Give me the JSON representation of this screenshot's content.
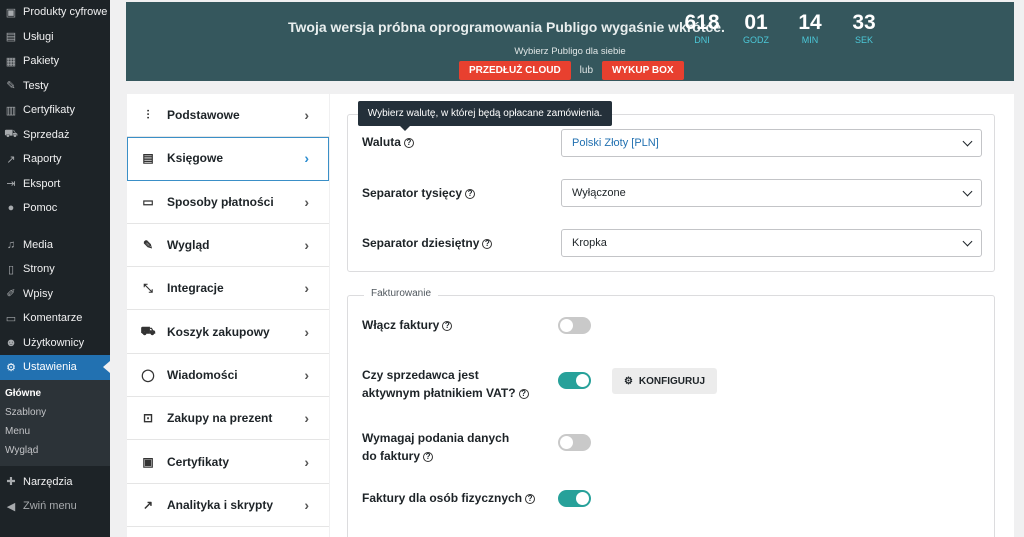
{
  "wp_menu": {
    "group1": [
      {
        "label": "Produkty cyfrowe",
        "icon": "product-icon"
      },
      {
        "label": "Usługi",
        "icon": "services-icon"
      },
      {
        "label": "Pakiety",
        "icon": "packages-icon"
      },
      {
        "label": "Testy",
        "icon": "tests-icon"
      },
      {
        "label": "Certyfikaty",
        "icon": "certificates-icon"
      },
      {
        "label": "Sprzedaż",
        "icon": "cart-icon"
      },
      {
        "label": "Raporty",
        "icon": "chart-icon"
      },
      {
        "label": "Eksport",
        "icon": "export-icon"
      },
      {
        "label": "Pomoc",
        "icon": "help-icon"
      }
    ],
    "group2": [
      {
        "label": "Media",
        "icon": "media-icon"
      },
      {
        "label": "Strony",
        "icon": "pages-icon"
      },
      {
        "label": "Wpisy",
        "icon": "pin-icon"
      },
      {
        "label": "Komentarze",
        "icon": "comments-icon"
      },
      {
        "label": "Użytkownicy",
        "icon": "users-icon"
      },
      {
        "label": "Ustawienia",
        "icon": "settings-icon"
      }
    ],
    "submenu": [
      "Główne",
      "Szablony",
      "Menu",
      "Wygląd"
    ],
    "tools": "Narzędzia",
    "collapse": "Zwiń menu"
  },
  "banner": {
    "message": "Twoja wersja próbna oprogramowania Publigo wygaśnie wkrótce.",
    "countdown": [
      {
        "value": "618",
        "label": "DNI"
      },
      {
        "value": "01",
        "label": "GODZ"
      },
      {
        "value": "14",
        "label": "MIN"
      },
      {
        "value": "33",
        "label": "SEK"
      }
    ],
    "choose": "Wybierz Publigo dla siebie",
    "btn_cloud": "PRZEDŁUŻ CLOUD",
    "or": "lub",
    "btn_box": "WYKUP BOX"
  },
  "settings_nav": [
    {
      "label": "Podstawowe",
      "icon": "sliders-icon"
    },
    {
      "label": "Księgowe",
      "icon": "document-icon"
    },
    {
      "label": "Sposoby płatności",
      "icon": "credit-card-icon"
    },
    {
      "label": "Wygląd",
      "icon": "pencil-icon"
    },
    {
      "label": "Integracje",
      "icon": "integrations-icon"
    },
    {
      "label": "Koszyk zakupowy",
      "icon": "cart-icon"
    },
    {
      "label": "Wiadomości",
      "icon": "message-icon"
    },
    {
      "label": "Zakupy na prezent",
      "icon": "gift-icon"
    },
    {
      "label": "Certyfikaty",
      "icon": "certificate-icon"
    },
    {
      "label": "Analityka i skrypty",
      "icon": "analytics-icon"
    }
  ],
  "currency_section": {
    "tooltip": "Wybierz walutę, w której będą opłacane zamówienia.",
    "currency_label": "Waluta",
    "currency_value": "Polski Złoty [PLN]",
    "thousands_label": "Separator tysięcy",
    "thousands_value": "Wyłączone",
    "decimal_label": "Separator dziesiętny",
    "decimal_value": "Kropka"
  },
  "invoice_section": {
    "legend": "Fakturowanie",
    "enable_invoices_label": "Włącz faktury",
    "enable_invoices": false,
    "vat_payer_label": "Czy sprzedawca jest aktywnym płatnikiem VAT?",
    "vat_payer": true,
    "configure_label": "KONFIGURUJ",
    "require_data_label": "Wymagaj podania danych do faktury",
    "require_data": false,
    "individuals_label": "Faktury dla osób fizycznych",
    "individuals": true
  },
  "colors": {
    "banner_bg": "#35575d",
    "accent_red": "#e8402f",
    "toggle_on": "#27a19a",
    "wp_active": "#2271b1"
  }
}
